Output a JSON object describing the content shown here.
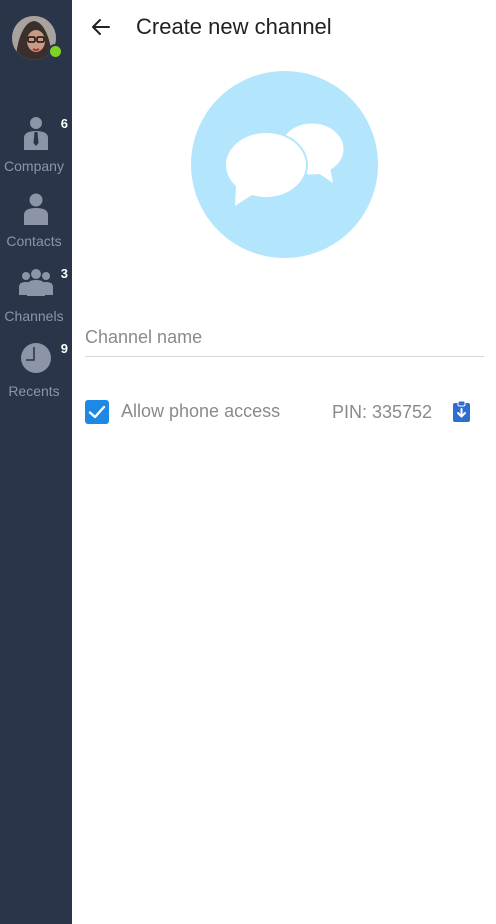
{
  "sidebar": {
    "avatar": {
      "icon": "user-avatar",
      "status_color": "#7ed321"
    },
    "items": [
      {
        "label": "Company",
        "badge": "6",
        "icon": "company-person-icon"
      },
      {
        "label": "Contacts",
        "badge": "",
        "icon": "contact-person-icon"
      },
      {
        "label": "Channels",
        "badge": "3",
        "icon": "group-icon"
      },
      {
        "label": "Recents",
        "badge": "9",
        "icon": "clock-icon"
      }
    ]
  },
  "header": {
    "title": "Create new channel",
    "back_icon": "arrow-left-icon"
  },
  "channel_avatar": {
    "icon": "chat-bubbles-icon",
    "color": "#b3e5fc"
  },
  "form": {
    "channel_name_placeholder": "Channel name",
    "channel_name_value": "",
    "allow_phone_access_label": "Allow phone access",
    "allow_phone_access_checked": true,
    "pin_text": "PIN: 335752",
    "copy_icon": "clipboard-download-icon"
  },
  "colors": {
    "sidebar_bg": "#2b3549",
    "accent": "#1e88e5",
    "sidebar_text": "#8b95a7"
  }
}
